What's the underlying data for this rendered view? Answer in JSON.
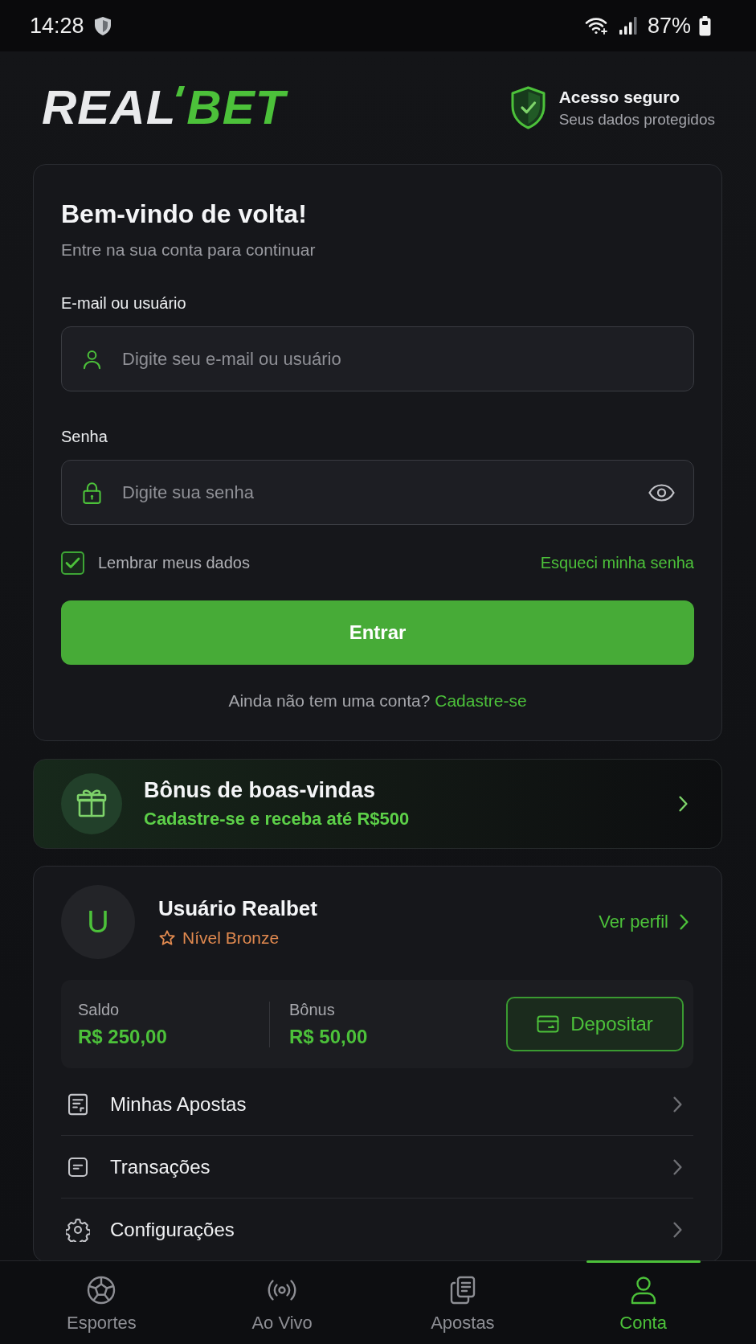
{
  "status_bar": {
    "time": "14:28",
    "battery": "87%"
  },
  "header": {
    "logo": {
      "text": "REAL",
      "accent": "BET"
    },
    "secure_badge": {
      "title": "Acesso seguro",
      "subtitle": "Seus dados protegidos"
    }
  },
  "login": {
    "title": "Bem-vindo de volta!",
    "subtitle": "Entre na sua conta para continuar",
    "fields": [
      {
        "kind": "text",
        "label": "E-mail ou usuário",
        "placeholder": "Digite seu e-mail ou usuário"
      },
      {
        "kind": "password",
        "label": "Senha",
        "placeholder": "Digite sua senha"
      }
    ],
    "remember": {
      "label": "Lembrar meus dados",
      "checked": true
    },
    "forgot_link": "Esqueci minha senha",
    "submit": "Entrar",
    "signup": {
      "prompt": "Ainda não tem uma conta?",
      "link": "Cadastre-se"
    }
  },
  "bonus_banner": {
    "title": "Bônus de boas-vindas",
    "subtitle": "Cadastre-se e receba até R$500"
  },
  "profile": {
    "initial": "U",
    "name": "Usuário Realbet",
    "level": "Nível Bronze",
    "profile_link": "Ver perfil",
    "balances": [
      {
        "label": "Saldo",
        "value": "R$ 250,00"
      },
      {
        "label": "Bônus",
        "value": "R$ 50,00"
      }
    ],
    "deposit": "Depositar",
    "menu": [
      {
        "kind": "bets",
        "label": "Minhas Apostas"
      },
      {
        "kind": "transactions",
        "label": "Transações"
      },
      {
        "kind": "settings",
        "label": "Configurações"
      }
    ]
  },
  "bottom_nav": [
    {
      "kind": "sports",
      "label": "Esportes",
      "selected": false
    },
    {
      "kind": "live",
      "label": "Ao Vivo",
      "selected": false
    },
    {
      "kind": "bets",
      "label": "Apostas",
      "selected": false
    },
    {
      "kind": "account",
      "label": "Conta",
      "selected": true
    }
  ]
}
